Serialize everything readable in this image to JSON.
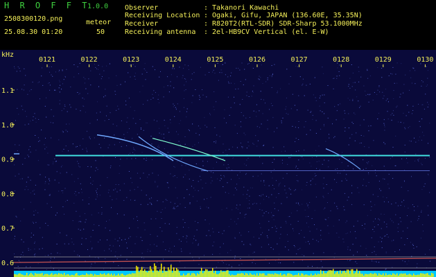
{
  "app": {
    "title": "H R O F F T",
    "version": "1.0.0"
  },
  "file": {
    "name": "2508300120.png",
    "datetime": "25.08.30 01:20"
  },
  "detector": {
    "label": "meteor",
    "count": "50"
  },
  "info": [
    {
      "label": "Observer",
      "value": "Takanori Kawachi"
    },
    {
      "label": "Receiving Location",
      "value": "Ogaki, Gifu, JAPAN (136.60E, 35.35N)"
    },
    {
      "label": "Receiver",
      "value": "R820T2(RTL-SDR) SDR-Sharp 53.1000MHz"
    },
    {
      "label": "Receiving antenna",
      "value": "2el-HB9CV Vertical (el. E-W)"
    }
  ],
  "plot": {
    "unit": "kHz",
    "time_ticks": [
      "0121",
      "0122",
      "0123",
      "0124",
      "0125",
      "0126",
      "0127",
      "0128",
      "0129",
      "0130"
    ],
    "freq_ticks": [
      "1.1",
      "1.0",
      "0.9",
      "0.8",
      "0.7",
      "0.6"
    ],
    "colors": {
      "background": "#0a0a3a",
      "carrier": "#40e0e0",
      "trail": "#6fa8ff",
      "bars": "#f7f000",
      "low_band": "#00c8ff"
    }
  }
}
